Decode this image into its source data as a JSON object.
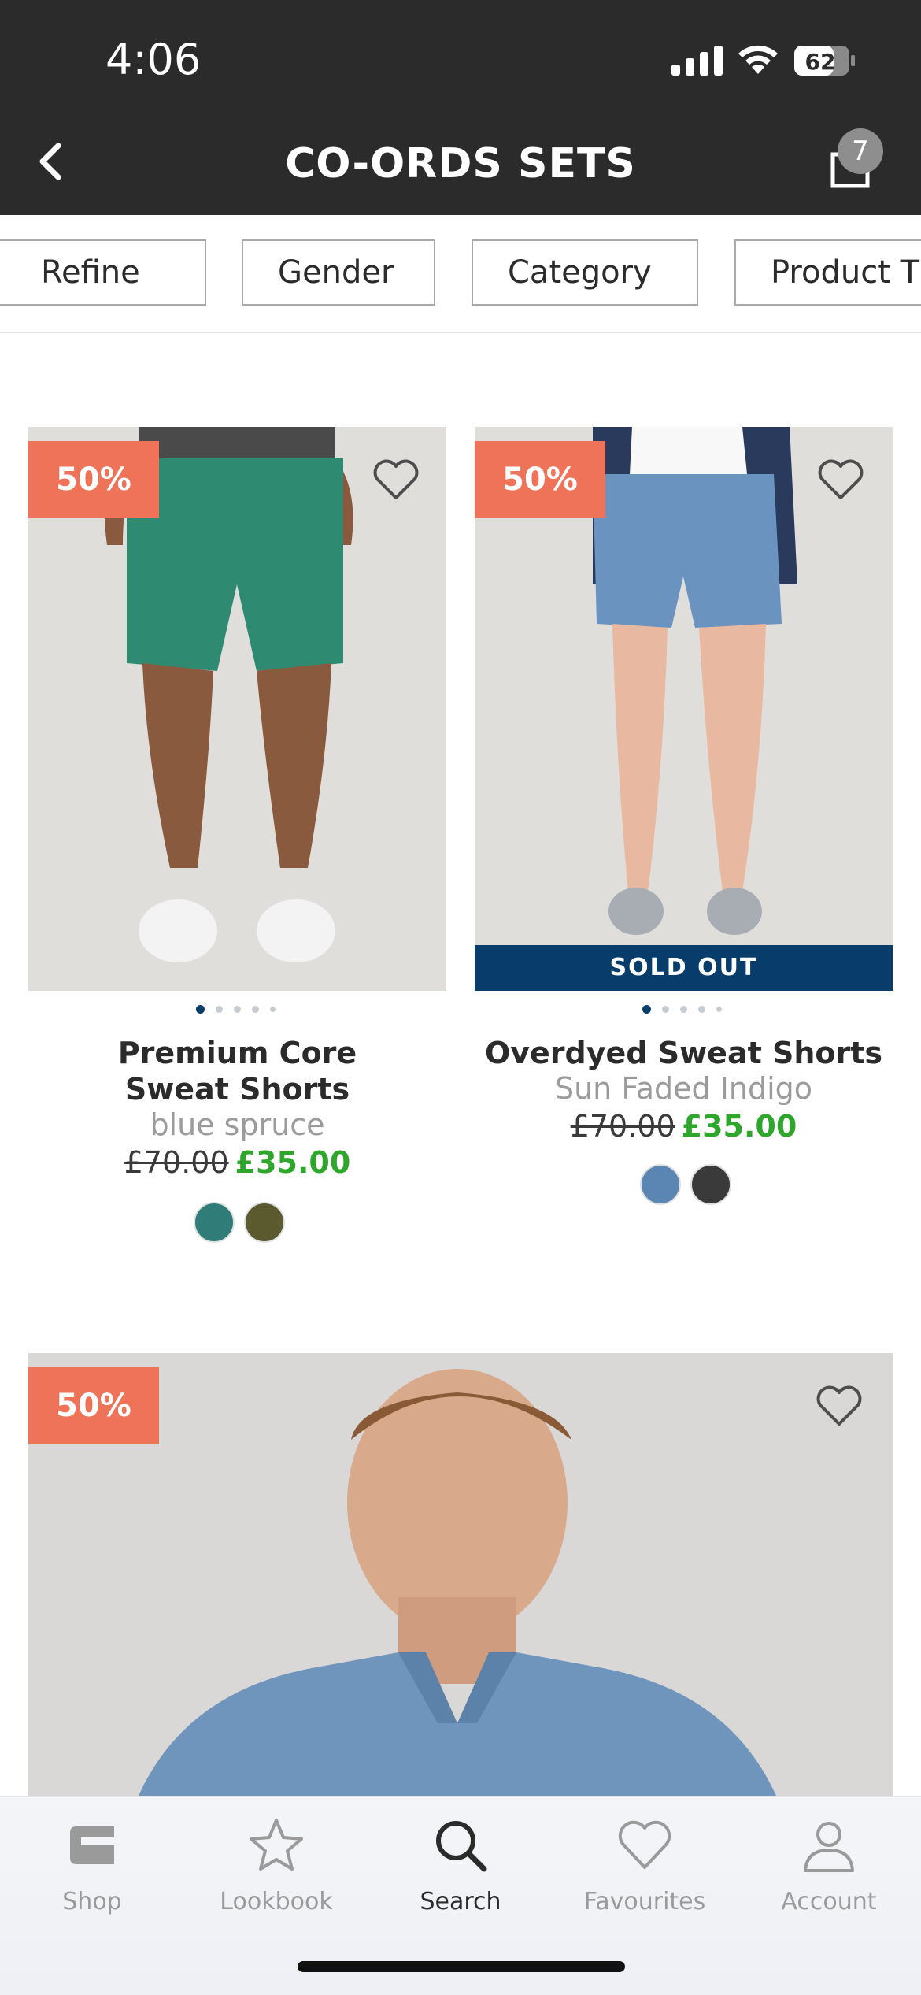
{
  "status_bar": {
    "time": "4:06",
    "battery": "62"
  },
  "header": {
    "title": "CO-ORDS SETS",
    "bag_count": "7"
  },
  "filters": [
    "Refine",
    "Gender",
    "Category",
    "Product T"
  ],
  "products": [
    {
      "discount": "50%",
      "name_line1": "Premium Core",
      "name_line2": "Sweat Shorts",
      "color": "blue spruce",
      "old_price": "£70.00",
      "new_price": "£35.00",
      "swatches": [
        "#2f7c78",
        "#5a5a2e"
      ],
      "dots": 5,
      "sold_out": ""
    },
    {
      "discount": "50%",
      "name_line1": "Overdyed Sweat Shorts",
      "name_line2": "",
      "color": "Sun Faded Indigo",
      "old_price": "£70.00",
      "new_price": "£35.00",
      "swatches": [
        "#5b86b4",
        "#3a3a3a"
      ],
      "dots": 5,
      "sold_out": "SOLD OUT"
    },
    {
      "discount": "50%"
    }
  ],
  "bottom_nav": [
    {
      "label": "Shop",
      "icon": "shop-icon"
    },
    {
      "label": "Lookbook",
      "icon": "star-icon"
    },
    {
      "label": "Search",
      "icon": "search-icon",
      "active": true
    },
    {
      "label": "Favourites",
      "icon": "heart-icon"
    },
    {
      "label": "Account",
      "icon": "person-icon"
    }
  ],
  "colors": {
    "accent_badge": "#ee7358",
    "sale_price": "#2ea52b",
    "sold_out_bar": "#083c6b",
    "header_bg": "#2b2b2b"
  }
}
